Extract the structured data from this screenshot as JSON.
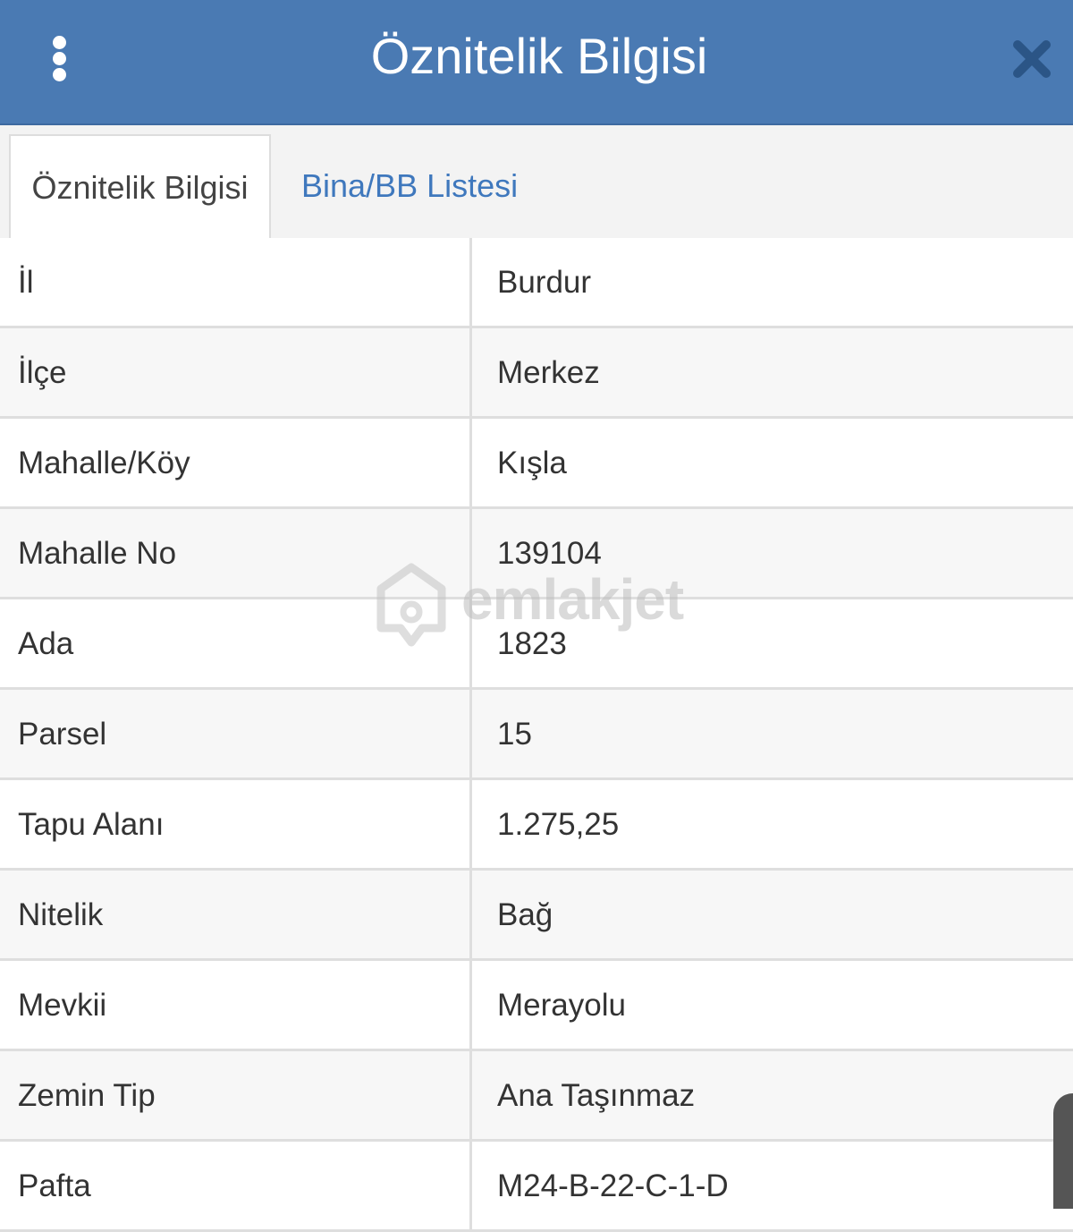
{
  "header": {
    "title": "Öznitelik Bilgisi"
  },
  "tabs": [
    {
      "label": "Öznitelik Bilgisi",
      "active": true
    },
    {
      "label": "Bina/BB Listesi",
      "active": false
    }
  ],
  "rows": [
    {
      "label": "İl",
      "value": "Burdur"
    },
    {
      "label": "İlçe",
      "value": "Merkez"
    },
    {
      "label": "Mahalle/Köy",
      "value": "Kışla"
    },
    {
      "label": "Mahalle No",
      "value": "139104"
    },
    {
      "label": "Ada",
      "value": "1823"
    },
    {
      "label": "Parsel",
      "value": "15"
    },
    {
      "label": "Tapu Alanı",
      "value": "1.275,25"
    },
    {
      "label": "Nitelik",
      "value": "Bağ"
    },
    {
      "label": "Mevkii",
      "value": "Merayolu"
    },
    {
      "label": "Zemin Tip",
      "value": "Ana Taşınmaz"
    },
    {
      "label": "Pafta",
      "value": "M24-B-22-C-1-D"
    }
  ],
  "watermark": {
    "text": "emlakjet"
  },
  "colors": {
    "header_bg": "#4a7ab3",
    "tab_link": "#3f78bd",
    "close_icon": "#2b5586"
  }
}
